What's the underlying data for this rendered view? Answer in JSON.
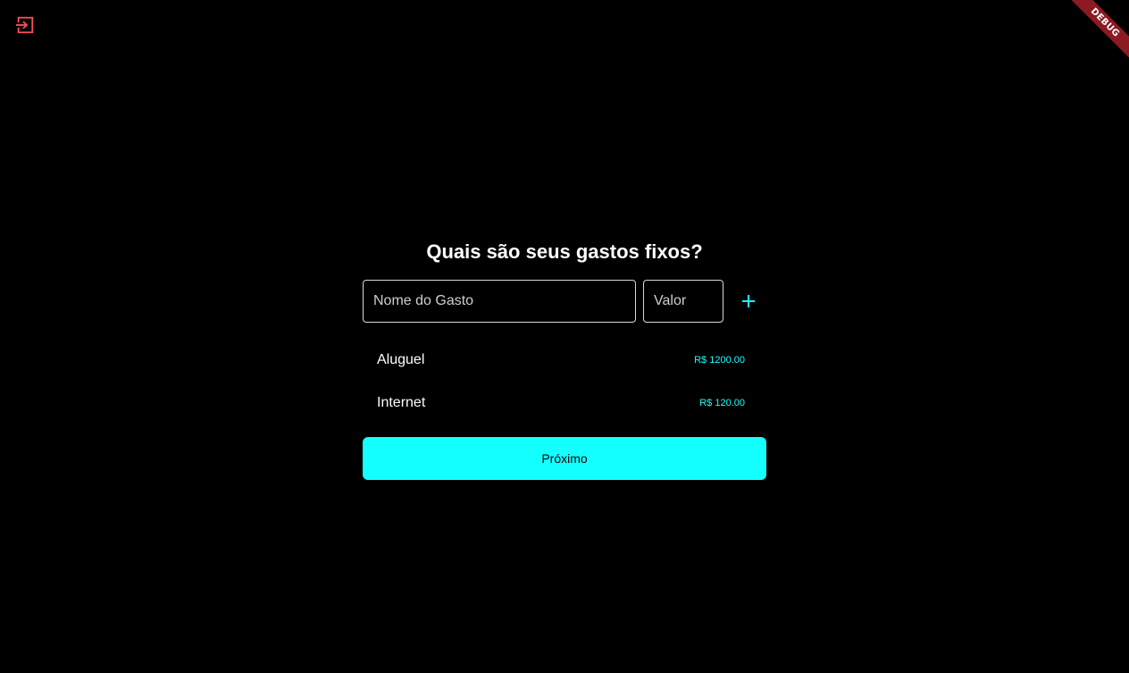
{
  "header": {
    "logout_icon": "logout-icon",
    "logout_color": "#ff4d5a",
    "debug_label": "DEBUG"
  },
  "form": {
    "title": "Quais são seus gastos fixos?",
    "name_placeholder": "Nome do Gasto",
    "name_value": "",
    "value_placeholder": "Valor",
    "value_value": "",
    "add_icon": "plus-icon"
  },
  "expenses": [
    {
      "name": "Aluguel",
      "value": "R$ 1200.00"
    },
    {
      "name": "Internet",
      "value": "R$ 120.00"
    }
  ],
  "actions": {
    "next_label": "Próximo"
  },
  "colors": {
    "background": "#000000",
    "accent": "#14ffff",
    "logout": "#ff4d5a",
    "debug_banner": "#8b1a22"
  }
}
